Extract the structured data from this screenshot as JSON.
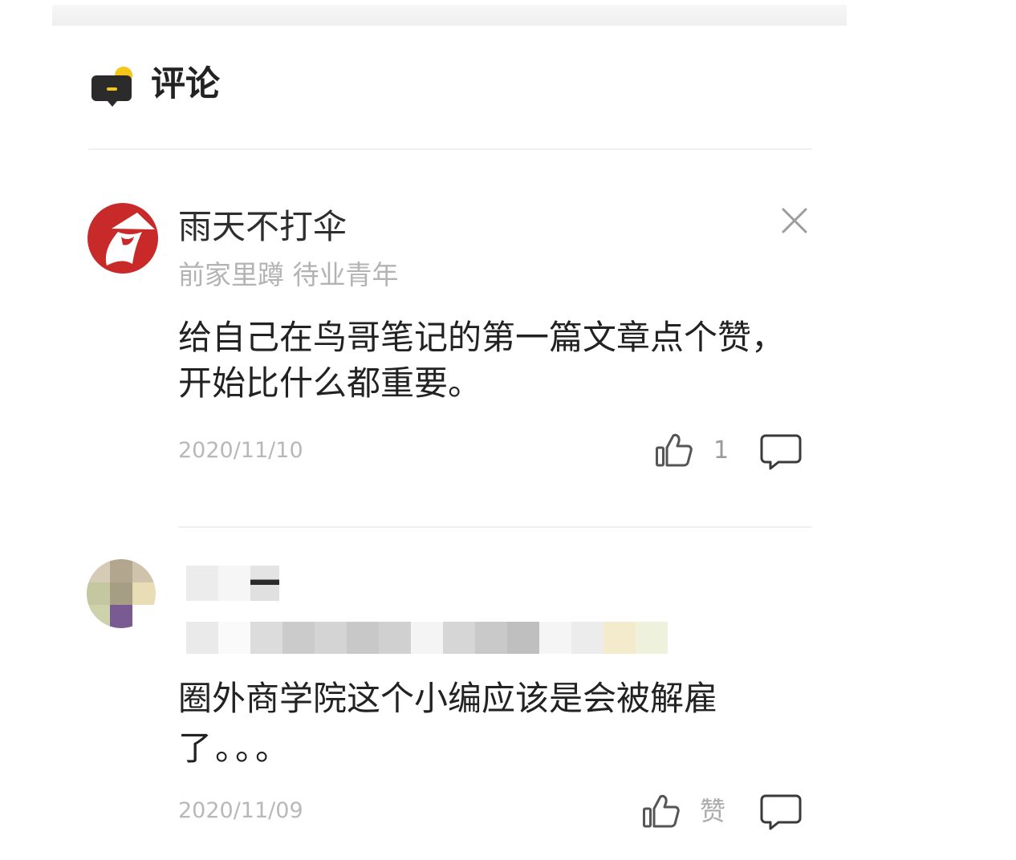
{
  "header": {
    "title": "评论",
    "icon": "comment-section-icon"
  },
  "colors": {
    "accent_yellow": "#f5c518",
    "icon_dark": "#2b2b2b",
    "avatar_red": "#c82a2a",
    "text_primary": "#222222",
    "text_secondary": "#b3b3b3"
  },
  "comments": [
    {
      "name": "雨天不打伞",
      "subtitle": "前家里蹲 待业青年",
      "text_lines": [
        "给自己在鸟哥笔记的第一篇文章点个赞，",
        "开始比什么都重要。"
      ],
      "date": "2020/11/10",
      "like_label": "1",
      "icons": [
        "thumbs-up-icon",
        "reply-bubble-icon",
        "close-icon"
      ]
    },
    {
      "text_lines": [
        "圈外商学院这个小编应该是会被解雇",
        "了。。。"
      ],
      "date": "2020/11/09",
      "like_label": "赞",
      "icons": [
        "thumbs-up-icon",
        "reply-bubble-icon"
      ]
    }
  ]
}
